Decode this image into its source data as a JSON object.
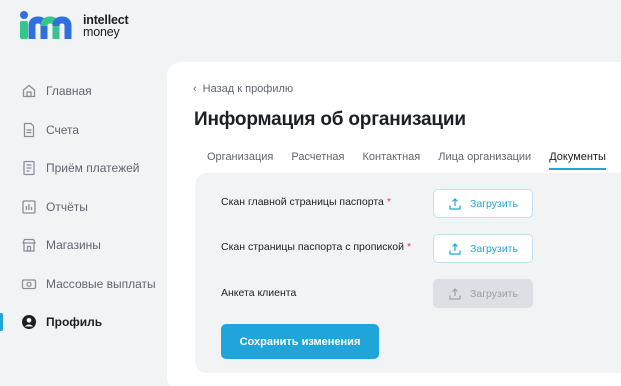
{
  "brand": {
    "line1": "intellect",
    "line2": "money",
    "colors": {
      "accent": "#1fa5d9",
      "logo_blue": "#2f6fe0",
      "logo_green": "#36c58a"
    }
  },
  "sidebar": {
    "items": [
      {
        "label": "Главная",
        "icon": "home-icon",
        "active": false
      },
      {
        "label": "Счета",
        "icon": "document-icon",
        "active": false
      },
      {
        "label": "Приём платежей",
        "icon": "receipt-icon",
        "active": false
      },
      {
        "label": "Отчёты",
        "icon": "chart-icon",
        "active": false
      },
      {
        "label": "Магазины",
        "icon": "store-icon",
        "active": false
      },
      {
        "label": "Массовые выплаты",
        "icon": "payout-icon",
        "active": false
      },
      {
        "label": "Профиль",
        "icon": "user-icon",
        "active": true
      }
    ]
  },
  "main": {
    "back_label": "Назад к профилю",
    "title": "Информация об организации",
    "tabs": [
      {
        "label": "Организация",
        "active": false
      },
      {
        "label": "Расчетная",
        "active": false
      },
      {
        "label": "Контактная",
        "active": false
      },
      {
        "label": "Лица организации",
        "active": false
      },
      {
        "label": "Документы",
        "active": true
      }
    ],
    "documents": [
      {
        "label": "Скан главной страницы паспорта",
        "required_mark": "*",
        "button": "Загрузить",
        "disabled": false
      },
      {
        "label": "Скан страницы паспорта с пропиской",
        "required_mark": "*",
        "button": "Загрузить",
        "disabled": false
      },
      {
        "label": "Анкета клиента",
        "required_mark": "",
        "button": "Загрузить",
        "disabled": true
      }
    ],
    "save_label": "Сохранить изменения"
  }
}
